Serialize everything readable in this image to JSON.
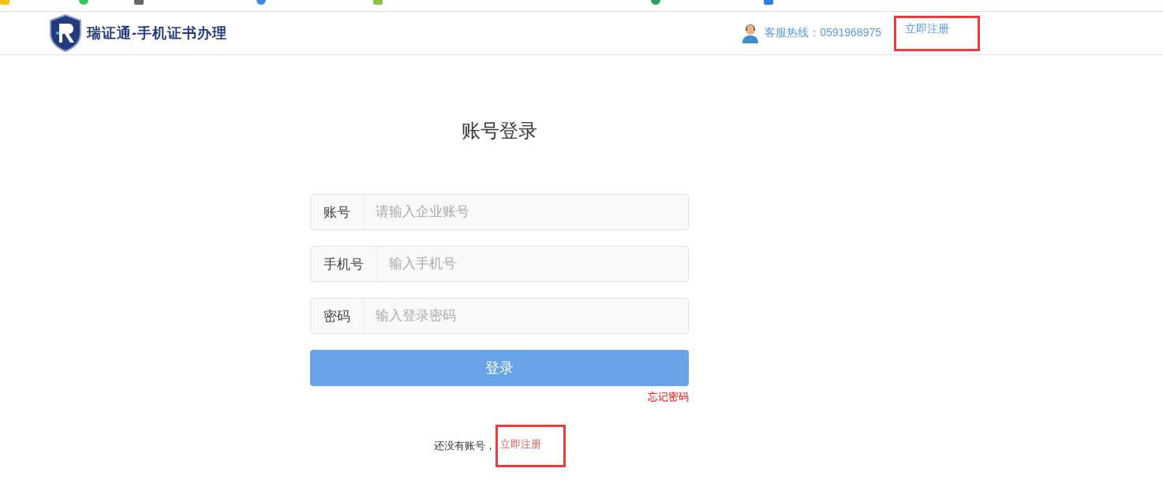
{
  "header": {
    "title": "瑞证通-手机证书办理",
    "hotline": "客服热线：0591968975",
    "register_link": "立即注册",
    "register_highlighted": true
  },
  "login": {
    "heading": "账号登录",
    "fields": [
      {
        "label": "账号",
        "placeholder": "请输入企业账号"
      },
      {
        "label": "手机号",
        "placeholder": "输入手机号"
      },
      {
        "label": "密码",
        "placeholder": "输入登录密码"
      }
    ],
    "submit": "登录",
    "forgot": "忘记密码",
    "signup_prompt": "还没有账号，",
    "signup_link": "立即注册",
    "signup_highlighted": true
  }
}
